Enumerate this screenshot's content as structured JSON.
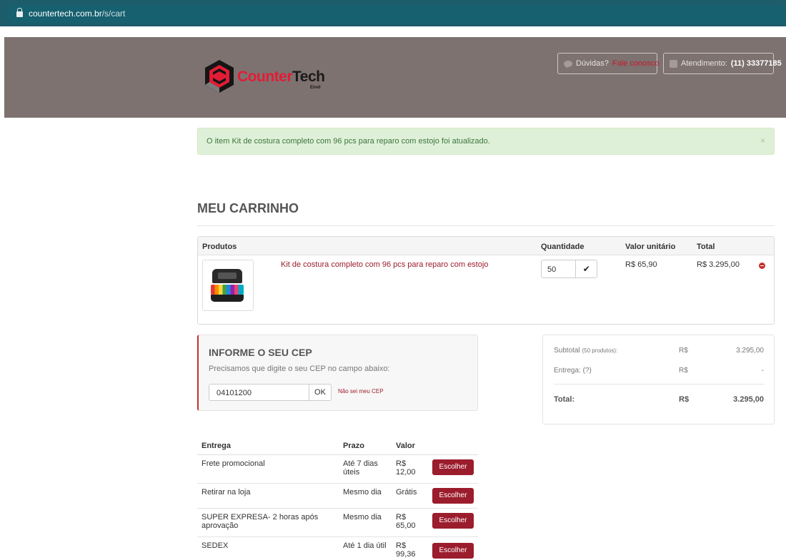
{
  "browser": {
    "url_domain": "countertech.com.br",
    "url_path": "/s/cart"
  },
  "header": {
    "brand_counter": "Counter",
    "brand_tech": "Tech",
    "brand_suffix": "Eireli",
    "help_label": "Dúvidas?",
    "help_link": "Fale conosco",
    "phone_label": "Atendimento:",
    "phone_number": "(11) 33377185"
  },
  "alert": {
    "message": "O item Kit de costura completo com 96 pcs para reparo com estojo foi atualizado.",
    "close": "×"
  },
  "cart": {
    "title": "MEU CARRINHO",
    "columns": [
      "Produtos",
      "Quantidade",
      "Valor unitário",
      "Total"
    ],
    "item": {
      "name": "Kit de costura completo com 96 pcs para reparo com estojo",
      "quantity": "50",
      "unit_price": "R$ 65,90",
      "total": "R$ 3.295,00"
    }
  },
  "cep": {
    "title": "INFORME O SEU CEP",
    "subtitle": "Precisamos que digite o seu CEP no campo abaixo:",
    "value": "04101200",
    "ok_label": "OK",
    "unknown_link": "Não sei meu CEP"
  },
  "summary": {
    "subtotal_label": "Subtotal",
    "subtotal_note": "(50 produtos):",
    "subtotal_currency": "R$",
    "subtotal_value": "3.295,00",
    "delivery_label": "Entrega: (?)",
    "delivery_currency": "R$",
    "delivery_value": "-",
    "total_label": "Total:",
    "total_currency": "R$",
    "total_value": "3.295,00"
  },
  "shipping": {
    "columns": [
      "Entrega",
      "Prazo",
      "Valor"
    ],
    "button_label": "Escolher",
    "options": [
      {
        "name": "Frete promocional",
        "term": "Até 7 dias úteis",
        "value": "R$ 12,00"
      },
      {
        "name": "Retirar na loja",
        "term": "Mesmo dia",
        "value": "Grátis"
      },
      {
        "name": "SUPER EXPRESA- 2 horas após aprovação",
        "term": "Mesmo dia",
        "value": "R$ 65,00"
      },
      {
        "name": "SEDEX",
        "term": "Até 1 dia útil",
        "value": "R$ 99,36"
      }
    ]
  },
  "colors": {
    "browser_bar": "#1d5c6b",
    "header_bg": "#7d7270",
    "brand_red": "#e31c35",
    "accent_maroon": "#9b1c2c",
    "alert_bg": "#dff0d8"
  },
  "icons": [
    "lock-icon",
    "chat-bubble-icon",
    "phone-icon",
    "checkmark-icon",
    "remove-circle-icon",
    "close-icon"
  ]
}
